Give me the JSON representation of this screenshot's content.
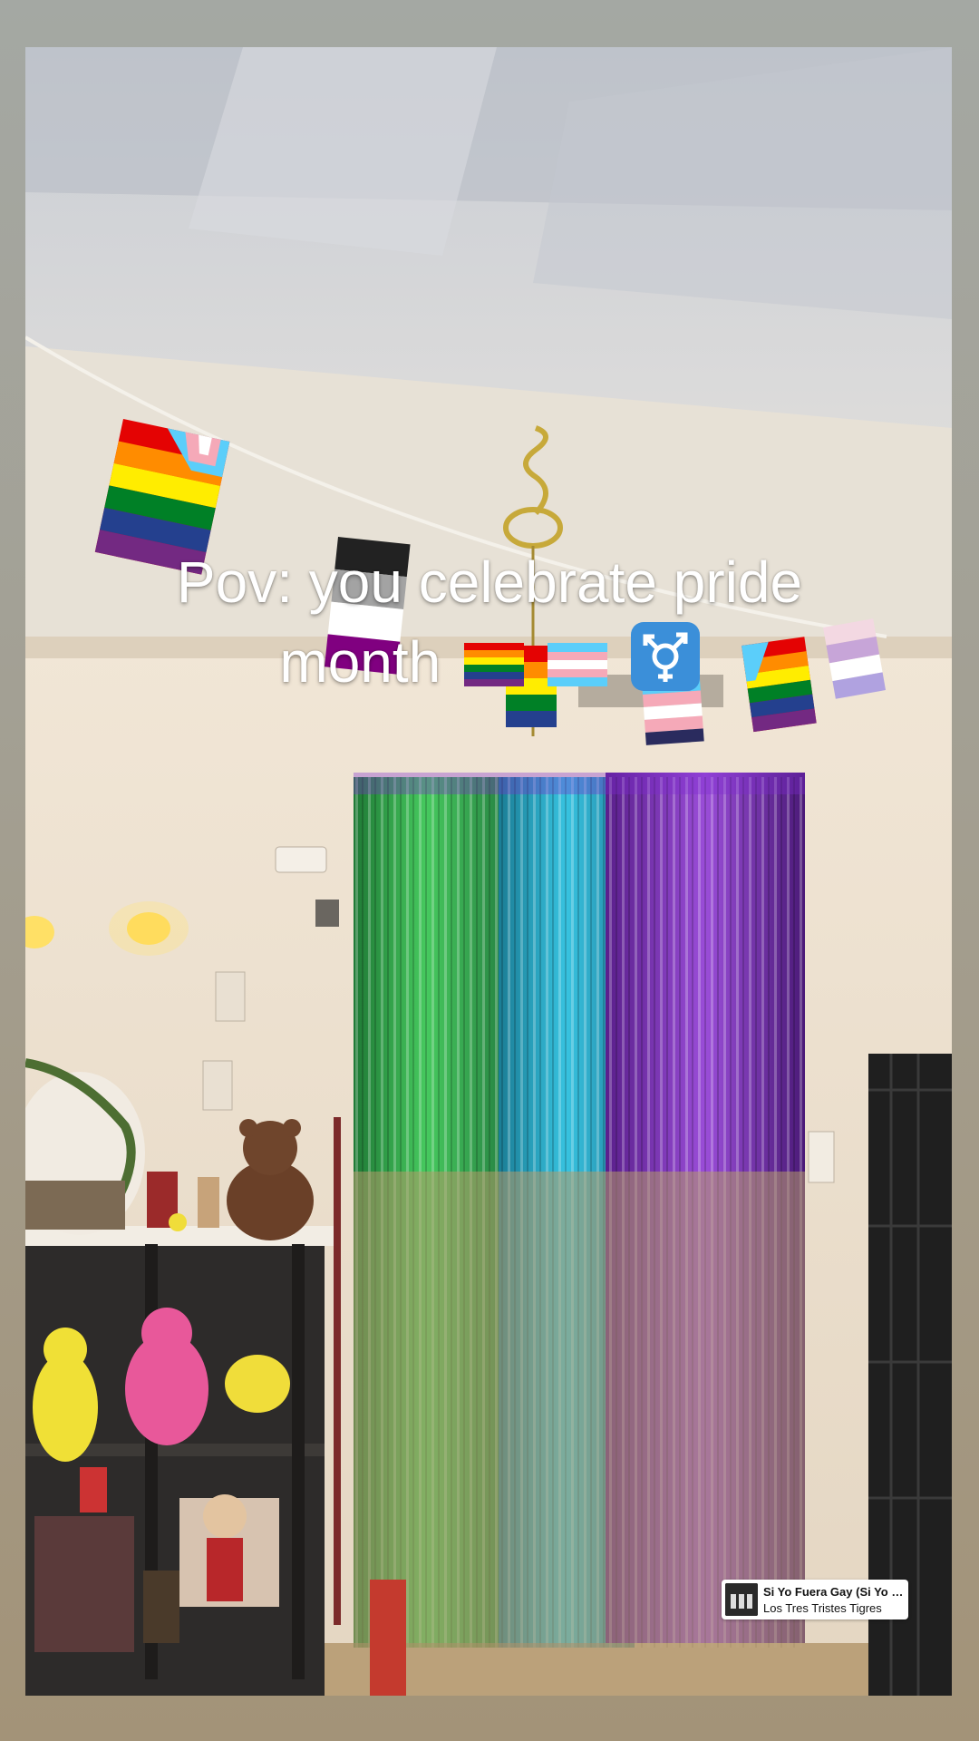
{
  "caption": {
    "line1": "Pov: you celebrate pride",
    "line2": "month",
    "emojis": [
      "rainbow-flag-emoji",
      "transgender-flag-emoji",
      "transgender-symbol-emoji"
    ]
  },
  "music": {
    "title": "Si Yo Fuera Gay (Si Yo F...",
    "artist": "Los Tres Tristes Tigres"
  },
  "colors": {
    "frame": "#a39a86",
    "streamer_green": "#2fa04a",
    "streamer_blue": "#1a8fb0",
    "streamer_purple": "#6b2a9e"
  }
}
